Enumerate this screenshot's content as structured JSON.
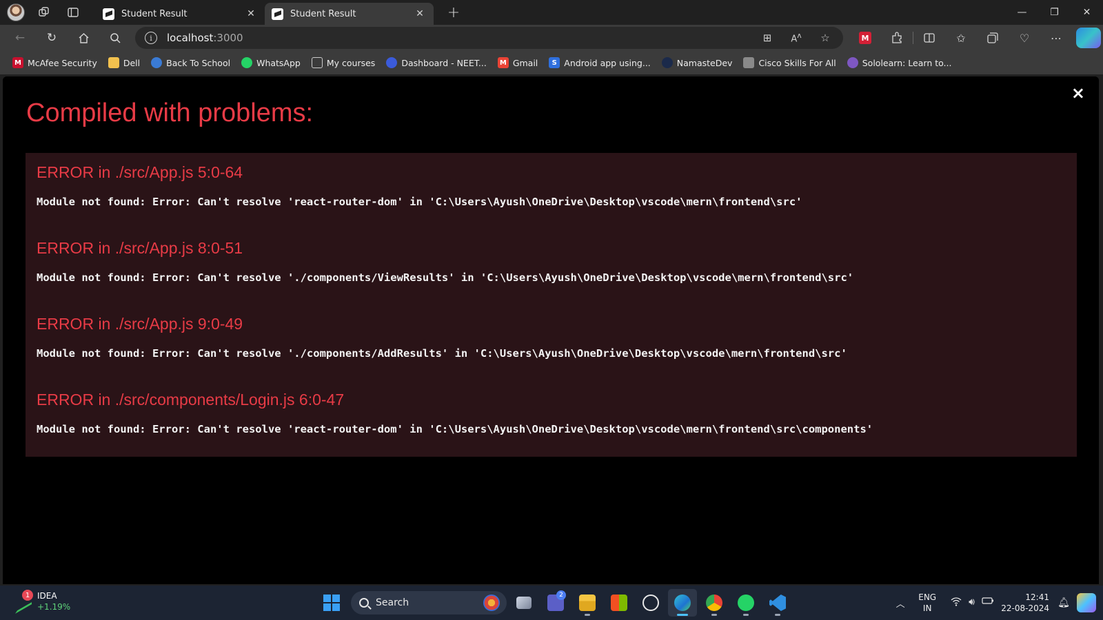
{
  "browser": {
    "tabs": [
      {
        "title": "Student Result",
        "active": false
      },
      {
        "title": "Student Result",
        "active": true
      }
    ],
    "address": {
      "host": "localhost",
      "port": ":3000"
    },
    "bookmarks": [
      {
        "label": "McAfee Security",
        "icon": "mcafee-icon",
        "color": "#c8102e"
      },
      {
        "label": "Dell",
        "icon": "folder-icon",
        "color": "#f2c14e"
      },
      {
        "label": "Back To School",
        "icon": "globe-icon",
        "color": "#3a7bd5"
      },
      {
        "label": "WhatsApp",
        "icon": "whatsapp-icon",
        "color": "#25d366"
      },
      {
        "label": "My courses",
        "icon": "page-icon",
        "color": "#cccccc"
      },
      {
        "label": "Dashboard - NEET...",
        "icon": "dashboard-icon",
        "color": "#3b5bdb"
      },
      {
        "label": "Gmail",
        "icon": "gmail-icon",
        "color": "#ea4335"
      },
      {
        "label": "Android app using...",
        "icon": "s-icon",
        "color": "#2f6fdd"
      },
      {
        "label": "NamasteDev",
        "icon": "namastedev-icon",
        "color": "#1b2a4a"
      },
      {
        "label": "Cisco Skills For All",
        "icon": "cisco-icon",
        "color": "#8a8a8a"
      },
      {
        "label": "Sololearn: Learn to...",
        "icon": "sololearn-icon",
        "color": "#7e57c2"
      }
    ]
  },
  "overlay": {
    "title": "Compiled with problems:",
    "close_glyph": "×",
    "errors": [
      {
        "header": "ERROR in ./src/App.js 5:0-64",
        "message": "Module not found: Error: Can't resolve 'react-router-dom' in 'C:\\Users\\Ayush\\OneDrive\\Desktop\\vscode\\mern\\frontend\\src'"
      },
      {
        "header": "ERROR in ./src/App.js 8:0-51",
        "message": "Module not found: Error: Can't resolve './components/ViewResults' in 'C:\\Users\\Ayush\\OneDrive\\Desktop\\vscode\\mern\\frontend\\src'"
      },
      {
        "header": "ERROR in ./src/App.js 9:0-49",
        "message": "Module not found: Error: Can't resolve './components/AddResults' in 'C:\\Users\\Ayush\\OneDrive\\Desktop\\vscode\\mern\\frontend\\src'"
      },
      {
        "header": "ERROR in ./src/components/Login.js 6:0-47",
        "message": "Module not found: Error: Can't resolve 'react-router-dom' in 'C:\\Users\\Ayush\\OneDrive\\Desktop\\vscode\\mern\\frontend\\src\\components'"
      }
    ]
  },
  "taskbar": {
    "stock": {
      "symbol": "IDEA",
      "change": "+1.19%",
      "badge": "1"
    },
    "search_label": "Search",
    "teams_badge": "2",
    "language": {
      "line1": "ENG",
      "line2": "IN"
    },
    "clock": {
      "time": "12:41",
      "date": "22-08-2024"
    }
  },
  "colors": {
    "error_red": "#e83b46",
    "overlay_panel": "#2a1317",
    "stock_up": "#5fd27a"
  }
}
